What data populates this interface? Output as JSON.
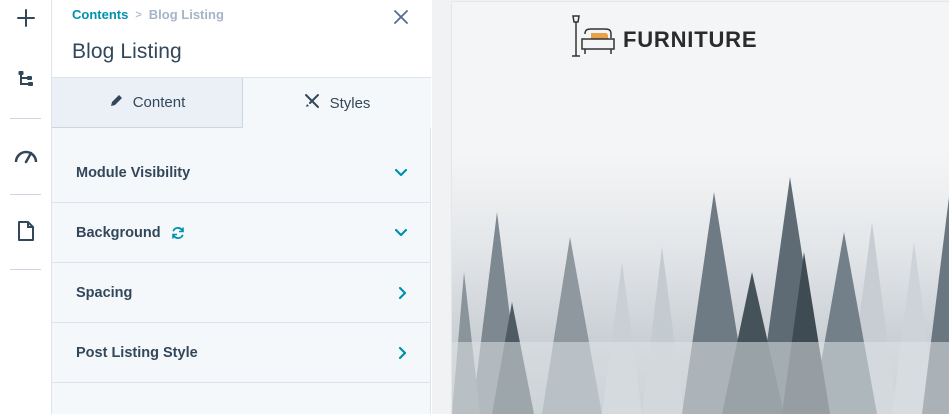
{
  "rail": {
    "icons": [
      "plus-icon",
      "tree-structure-icon",
      "gauge-icon",
      "document-icon"
    ]
  },
  "panel": {
    "breadcrumb": {
      "parent": "Contents",
      "separator": ">",
      "current": "Blog Listing"
    },
    "title": "Blog Listing",
    "tabs": [
      {
        "label": "Content",
        "icon": "pencil-icon",
        "active": false
      },
      {
        "label": "Styles",
        "icon": "brush-icon",
        "active": true
      }
    ],
    "sections": [
      {
        "label": "Module Visibility",
        "state": "expanded",
        "chevron": "chevron-down-icon"
      },
      {
        "label": "Background",
        "state": "expanded",
        "chevron": "chevron-down-icon",
        "extra_icon": "refresh-icon"
      },
      {
        "label": "Spacing",
        "state": "collapsed",
        "chevron": "chevron-right-icon"
      },
      {
        "label": "Post Listing Style",
        "state": "collapsed",
        "chevron": "chevron-right-icon"
      }
    ]
  },
  "preview": {
    "logo_text": "FURNITURE"
  },
  "colors": {
    "accent": "#0091ae",
    "text": "#33475b",
    "panel_bg": "#f5f8fa"
  }
}
